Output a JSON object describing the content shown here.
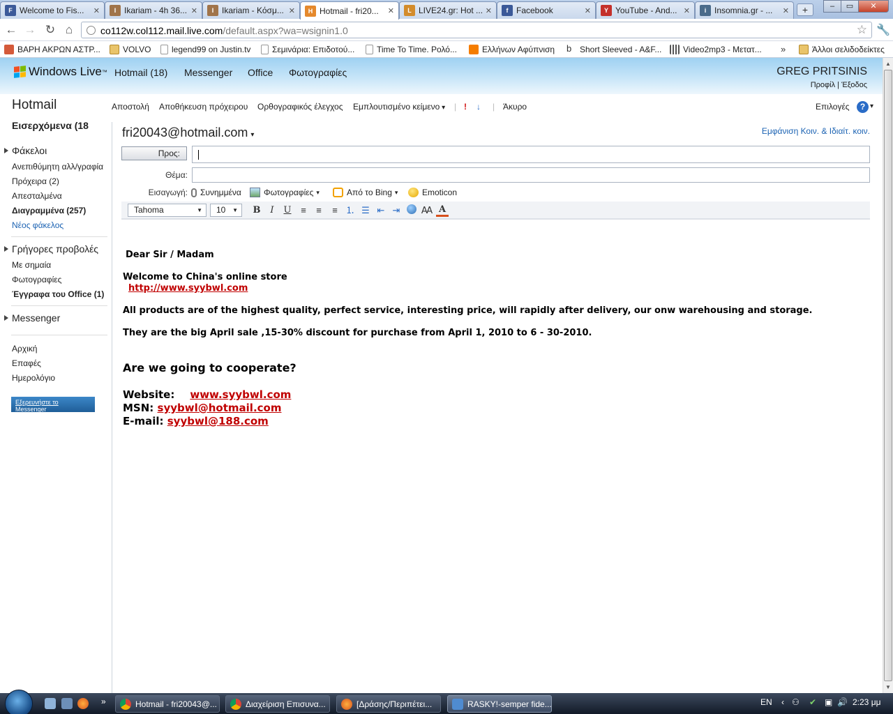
{
  "browser": {
    "tabs": [
      {
        "title": "Welcome to Fis...",
        "favicon": "F",
        "color": "#3c5a99"
      },
      {
        "title": "Ikariam - 4h 36...",
        "favicon": "I",
        "color": "#a0744a"
      },
      {
        "title": "Ikariam - Κόσμ...",
        "favicon": "I",
        "color": "#a0744a"
      },
      {
        "title": "Hotmail - fri20...",
        "favicon": "H",
        "color": "#e5892c"
      },
      {
        "title": "LIVE24.gr: Hot ...",
        "favicon": "L",
        "color": "#d38c2c"
      },
      {
        "title": "Facebook",
        "favicon": "f",
        "color": "#3b5998"
      },
      {
        "title": "YouTube - And...",
        "favicon": "Y",
        "color": "#c4302b"
      },
      {
        "title": "Insomnia.gr - ...",
        "favicon": "i",
        "color": "#4a6b8a"
      }
    ],
    "url_host": "co112w.col112.mail.live.com",
    "url_path": "/default.aspx?wa=wsignin1.0",
    "bookmarks": [
      {
        "label": "ΒΑΡΗ ΑΚΡΩΝ ΑΣΤΡ...",
        "icon": "img"
      },
      {
        "label": "VOLVO",
        "icon": "folder"
      },
      {
        "label": "legend99 on Justin.tv",
        "icon": "page"
      },
      {
        "label": "Σεμινάρια: Επιδοτού...",
        "icon": "page"
      },
      {
        "label": "Time To Time. Ρολό...",
        "icon": "page"
      },
      {
        "label": "Ελλήνων Αφύπνιση",
        "icon": "blogger"
      },
      {
        "label": "Short Sleeved - A&F...",
        "icon": "b"
      },
      {
        "label": "Video2mp3 - Μετατ...",
        "icon": "grid"
      }
    ],
    "other_bookmarks": "Άλλοι σελιδοδείκτες"
  },
  "header": {
    "brand": "Windows Live",
    "brand_tm": "™",
    "nav": [
      "Hotmail (18)",
      "Messenger",
      "Office",
      "Φωτογραφίες"
    ],
    "user": "GREG PRITSINIS",
    "profile": "Προφίλ",
    "separator": "|",
    "signout": "Έξοδος"
  },
  "sidebar": {
    "title": "Hotmail",
    "inbox": "Εισερχόμενα (18",
    "folders_header": "Φάκελοι",
    "folders": [
      "Ανεπιθύμητη αλλ/γραφία",
      "Πρόχειρα (2)",
      "Απεσταλμένα",
      "Διαγραμμένα (257)"
    ],
    "new_folder": "Νέος φάκελος",
    "quick_header": "Γρήγορες προβολές",
    "quick": [
      "Με σημαία",
      "Φωτογραφίες",
      "Έγγραφα του Office (1)"
    ],
    "messenger_header": "Messenger",
    "links": [
      "Αρχική",
      "Επαφές",
      "Ημερολόγιο"
    ],
    "ad": "Εξερευνήστε το Messenger"
  },
  "compose_toolbar": {
    "send": "Αποστολή",
    "save_draft": "Αποθήκευση πρόχειρου",
    "spellcheck": "Ορθογραφικός έλεγχος",
    "rich_text": "Εμπλουτισμένο κείμενο",
    "cancel": "Άκυρο",
    "options": "Επιλογές",
    "help": "?"
  },
  "compose": {
    "from": "fri20043@hotmail.com",
    "show_cc": "Εμφάνιση Κοιν. & Ιδιαίτ. κοιν.",
    "to_label": "Προς:",
    "to_value": "",
    "subject_label": "Θέμα:",
    "subject_value": "",
    "insert_label": "Εισαγωγή:",
    "insert": [
      "Συνημμένα",
      "Φωτογραφίες",
      "Από το Bing",
      "Emoticon"
    ],
    "font": "Tahoma",
    "size": "10"
  },
  "message": {
    "greeting": "Dear Sir / Madam",
    "welcome": "Welcome to China's online store",
    "link": "http://www.syybwl.com",
    "line1": "All products are of the highest quality, perfect service, interesting price, will rapidly after delivery, our onw warehousing and storage.",
    "line2": "They are the big April sale ,15-30% discount for purchase from April 1, 2010 to 6 - 30-2010.",
    "question": "Are we going to cooperate?",
    "website_label": "Website:",
    "website": "www.syybwl.com",
    "msn_label": "MSN:",
    "msn": "syybwl@hotmail.com",
    "email_label": "E-mail:",
    "email": "syybwl@188.com"
  },
  "taskbar": {
    "tasks": [
      "Hotmail - fri20043@...",
      "Διαχείριση Επισυνα...",
      "[Δράσης/Περιπέτει...",
      "RASKY!-semper fide..."
    ],
    "lang": "EN",
    "clock": "2:23 μμ"
  }
}
